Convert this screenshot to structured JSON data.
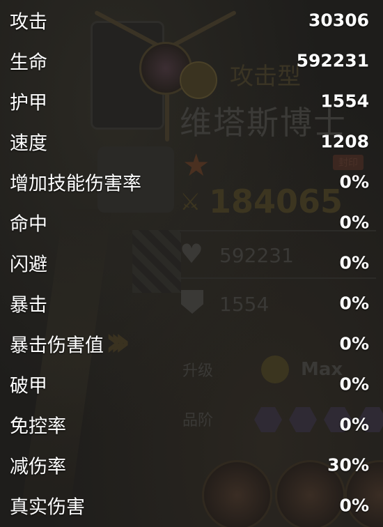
{
  "stats": [
    {
      "label": "攻击",
      "value": "30306"
    },
    {
      "label": "生命",
      "value": "592231"
    },
    {
      "label": "护甲",
      "value": "1554"
    },
    {
      "label": "速度",
      "value": "1208"
    },
    {
      "label": "增加技能伤害率",
      "value": "0%"
    },
    {
      "label": "命中",
      "value": "0%"
    },
    {
      "label": "闪避",
      "value": "0%"
    },
    {
      "label": "暴击",
      "value": "0%"
    },
    {
      "label": "暴击伤害值",
      "value": "0%"
    },
    {
      "label": "破甲",
      "value": "0%"
    },
    {
      "label": "免控率",
      "value": "0%"
    },
    {
      "label": "减伤率",
      "value": "30%"
    },
    {
      "label": "真实伤害",
      "value": "0%"
    }
  ],
  "background": {
    "hero_type": "攻击型",
    "hero_name": "维塔斯博士",
    "tag": "封印",
    "power": "184065",
    "hp": "592231",
    "armor": "1554",
    "upgrade_label": "升级",
    "upgrade_value": "Max",
    "rank_label": "品阶"
  },
  "colors": {
    "overlay_bg": "#1d1c1a",
    "text": "#ffffff"
  }
}
